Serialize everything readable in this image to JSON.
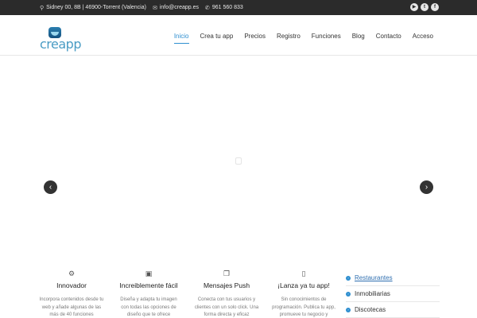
{
  "topbar": {
    "address": "Sidney 00, 8B | 46900-Torrent (Valencia)",
    "email": "info@creapp.es",
    "phone": "961 560 833",
    "social": [
      {
        "icon": "youtube-icon",
        "glyph": "▶"
      },
      {
        "icon": "twitter-icon",
        "glyph": "t"
      },
      {
        "icon": "facebook-icon",
        "glyph": "f"
      }
    ]
  },
  "header": {
    "logo_text": "creapp",
    "nav": [
      {
        "label": "Inicio",
        "active": true
      },
      {
        "label": "Crea tu app"
      },
      {
        "label": "Precios"
      },
      {
        "label": "Registro"
      },
      {
        "label": "Funciones"
      },
      {
        "label": "Blog"
      },
      {
        "label": "Contacto"
      },
      {
        "label": "Acceso"
      }
    ]
  },
  "slider": {
    "prev_glyph": "‹",
    "next_glyph": "›"
  },
  "features": [
    {
      "icon": "gears-icon",
      "glyph": "⚙",
      "title": "Innovador",
      "desc": "Incorpora contenidos desde tu web y añade algunas de las más de 40 funciones"
    },
    {
      "icon": "video-clapper-icon",
      "glyph": "▣",
      "title": "Increiblemente fácil",
      "desc": "Diseña y adapta tu imagen con todas las opciones de diseño que te ofrece"
    },
    {
      "icon": "copy-windows-icon",
      "glyph": "❐",
      "title": "Mensajes Push",
      "desc": "Conecta con tus usuarios y clientes con un solo click. Una forma directa y eficaz"
    },
    {
      "icon": "smartphone-icon",
      "glyph": "▯",
      "title": "¡Lanza ya tu app!",
      "desc": "Sin conocimientos de programación. Publica tu app, promueve tu negocio y"
    }
  ],
  "sidebar": {
    "items": [
      {
        "label": "Restaurantes",
        "active": true
      },
      {
        "label": "Inmobiliarias"
      },
      {
        "label": "Discotecas"
      }
    ]
  },
  "colors": {
    "accent": "#2f8fd0",
    "topbar": "#2b2b2b"
  }
}
